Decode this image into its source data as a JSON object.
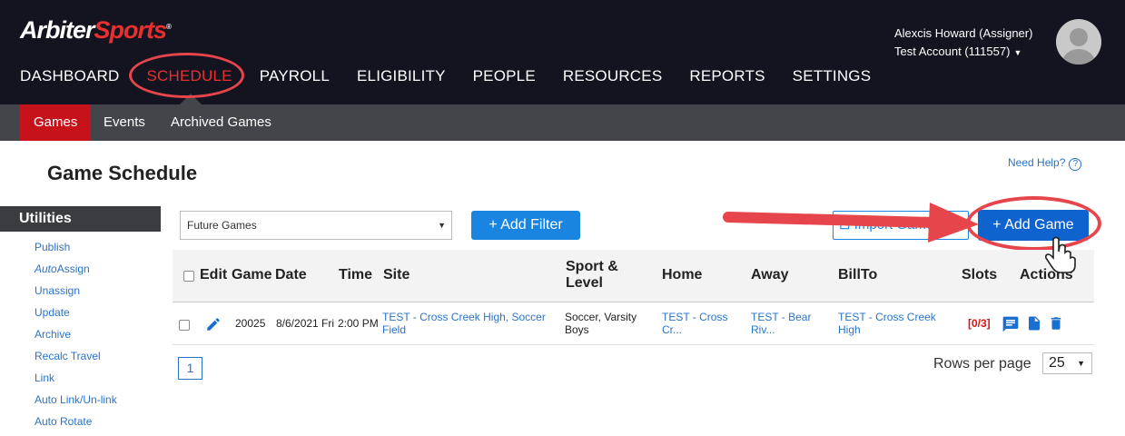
{
  "brand": {
    "part1": "Arbiter",
    "part2": "Sports",
    "tm": "®"
  },
  "nav": {
    "items": [
      "DASHBOARD",
      "SCHEDULE",
      "PAYROLL",
      "ELIGIBILITY",
      "PEOPLE",
      "RESOURCES",
      "REPORTS",
      "SETTINGS"
    ],
    "active": "SCHEDULE"
  },
  "user": {
    "name": "Alexcis Howard (Assigner)",
    "account": "Test Account (111557)"
  },
  "subnav": {
    "tabs": [
      "Games",
      "Events",
      "Archived Games"
    ],
    "active": "Games"
  },
  "page": {
    "title": "Game Schedule",
    "help": "Need Help?"
  },
  "utilities": {
    "title": "Utilities",
    "items": [
      "Publish",
      "AutoAssign",
      "Unassign",
      "Update",
      "Archive",
      "Recalc Travel",
      "Link",
      "Auto Link/Un-link",
      "Auto Rotate"
    ]
  },
  "toolbar": {
    "filter_select_value": "Future Games",
    "add_filter": "+ Add Filter",
    "import": "Import Games",
    "add_game": "+ Add Game"
  },
  "table": {
    "headers": [
      "Edit",
      "Game",
      "Date",
      "Time",
      "Site",
      "Sport & Level",
      "Home",
      "Away",
      "BillTo",
      "Slots",
      "Actions"
    ],
    "rows": [
      {
        "game": "20025",
        "date": "8/6/2021 Fri",
        "time": "2:00 PM",
        "site": "TEST - Cross Creek High, Soccer Field",
        "sport_level": "Soccer, Varsity Boys",
        "home": "TEST - Cross Cr...",
        "away": "TEST - Bear Riv...",
        "billto": "TEST - Cross Creek High",
        "slots": "[0/3]"
      }
    ]
  },
  "pagination": {
    "page": "1",
    "rows_per_page_label": "Rows per page",
    "rows_per_page": "25"
  },
  "colors": {
    "accent_red": "#e8312f",
    "primary_blue": "#1a85e0",
    "dark_bg": "#141420"
  }
}
